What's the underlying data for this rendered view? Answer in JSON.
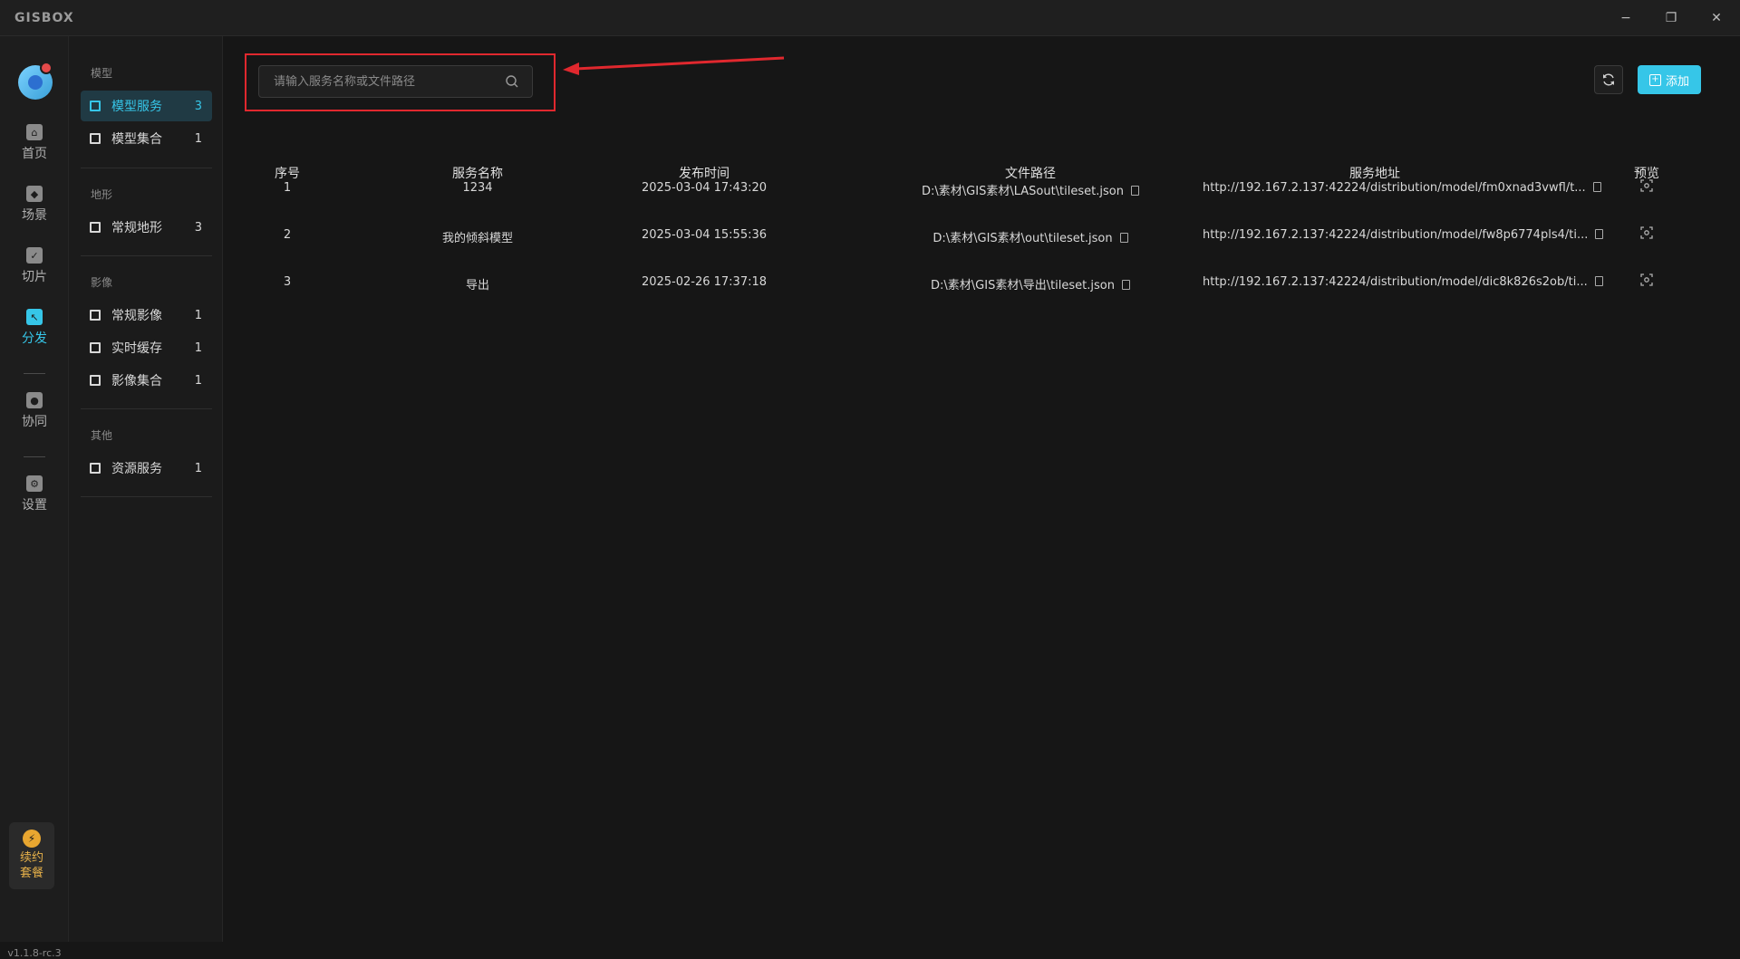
{
  "app": {
    "logo": "GISBOX"
  },
  "window_controls": {
    "minimize": "−",
    "maximize": "❐",
    "close": "✕"
  },
  "rail": {
    "items": [
      {
        "label": "首页",
        "icon": "home-icon"
      },
      {
        "label": "场景",
        "icon": "scene-icon"
      },
      {
        "label": "切片",
        "icon": "tile-icon"
      },
      {
        "label": "分发",
        "icon": "distribute-icon",
        "active": true
      },
      {
        "label": "协同",
        "icon": "collab-icon"
      },
      {
        "label": "设置",
        "icon": "settings-icon"
      }
    ],
    "renew": {
      "line1": "续约",
      "line2": "套餐",
      "icon": "lightning-icon"
    },
    "version": "v1.1.8-rc.3"
  },
  "subnav": {
    "groups": [
      {
        "title": "模型",
        "items": [
          {
            "label": "模型服务",
            "count": "3",
            "active": true
          },
          {
            "label": "模型集合",
            "count": "1"
          }
        ]
      },
      {
        "title": "地形",
        "items": [
          {
            "label": "常规地形",
            "count": "3"
          }
        ]
      },
      {
        "title": "影像",
        "items": [
          {
            "label": "常规影像",
            "count": "1"
          },
          {
            "label": "实时缓存",
            "count": "1"
          },
          {
            "label": "影像集合",
            "count": "1"
          }
        ]
      },
      {
        "title": "其他",
        "items": [
          {
            "label": "资源服务",
            "count": "1"
          }
        ]
      }
    ]
  },
  "search": {
    "placeholder": "请输入服务名称或文件路径",
    "value": ""
  },
  "toolbar": {
    "add_label": "添加"
  },
  "table": {
    "columns": [
      "序号",
      "服务名称",
      "发布时间",
      "文件路径",
      "服务地址",
      "预览"
    ],
    "rows": [
      {
        "index": "1",
        "name": "1234",
        "time": "2025-03-04 17:43:20",
        "path": "D:\\素材\\GIS素材\\LASout\\tileset.json",
        "url": "http://192.167.2.137:42224/distribution/model/fm0xnad3vwfl/t..."
      },
      {
        "index": "2",
        "name": "我的倾斜模型",
        "time": "2025-03-04 15:55:36",
        "path": "D:\\素材\\GIS素材\\out\\tileset.json",
        "url": "http://192.167.2.137:42224/distribution/model/fw8p6774pls4/ti..."
      },
      {
        "index": "3",
        "name": "导出",
        "time": "2025-02-26 17:37:18",
        "path": "D:\\素材\\GIS素材\\导出\\tileset.json",
        "url": "http://192.167.2.137:42224/distribution/model/dic8k826s2ob/ti..."
      }
    ]
  },
  "colors": {
    "accent": "#36c6e8",
    "highlight": "#e0282e",
    "background": "#161616"
  }
}
